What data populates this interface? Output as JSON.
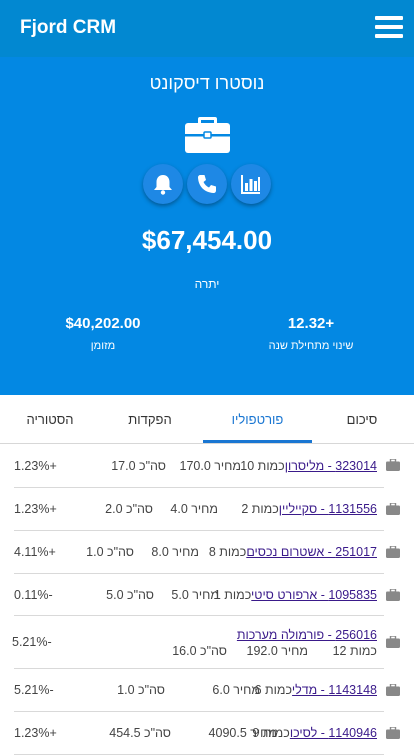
{
  "app": {
    "title": "Fjord CRM",
    "menu_icon": "hamburger-menu-icon"
  },
  "colors": {
    "header": "#0288d1",
    "hero": "#0388e3",
    "accent": "#1976d2",
    "link": "#3a1a8a"
  },
  "account": {
    "name": "נוסטרו דיסקונט",
    "icon": "briefcase-icon",
    "actions": [
      {
        "icon": "bell-icon"
      },
      {
        "icon": "phone-icon"
      },
      {
        "icon": "bar-chart-icon"
      }
    ],
    "balance": "$67,454.00",
    "balance_label": "יתרה",
    "stats": [
      {
        "value": "$40,202.00",
        "label": "מזומן"
      },
      {
        "value": "12.32+",
        "label": "שינוי מתחילת שנה"
      }
    ]
  },
  "tabs": [
    {
      "label": "סיכום",
      "active": false
    },
    {
      "label": "פורטפוליו",
      "active": true
    },
    {
      "label": "הפקדות",
      "active": false
    },
    {
      "label": "הסטוריה",
      "active": false
    }
  ],
  "holdings": [
    {
      "name": "323014 - מליסרון",
      "qty": "כמות 10",
      "price": "מחיר 170.0",
      "total": "סה\"כ 17.0",
      "change": "1.23%+"
    },
    {
      "name": "1131556 - סקייליין",
      "qty": "כמות 2",
      "price": "מחיר 4.0",
      "total": "סה\"כ 2.0",
      "change": "1.23%+"
    },
    {
      "name": "251017 - אשטרום נכסים",
      "qty": "כמות 8",
      "price": "מחיר 8.0",
      "total": "סה\"כ 1.0",
      "change": "4.11%+"
    },
    {
      "name": "1095835 - ארפורט סיטי",
      "qty": "כמות 1",
      "price": "מחיר 5.0",
      "total": "סה\"כ 5.0",
      "change": "0.11%-"
    },
    {
      "name": "256016 - פורמולה מערכות",
      "qty": "כמות 12",
      "price": "מחיר 192.0",
      "total": "סה\"כ 16.0",
      "change": "5.21%-"
    },
    {
      "name": "1143148 - מדלי",
      "qty": "כמות 6",
      "price": "מחיר 6.0",
      "total": "סה\"כ 1.0",
      "change": "5.21%-"
    },
    {
      "name": "1140946 - לסיכו",
      "qty": "כמות 9",
      "price": "מחיר 4090.5",
      "total": "סה\"כ 454.5",
      "change": "1.23%+"
    }
  ]
}
